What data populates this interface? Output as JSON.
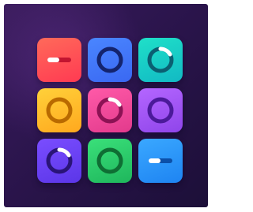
{
  "icon": {
    "name": "launchpad-app-icon",
    "background_colors": [
      "#3a1c5c",
      "#1c0f38"
    ],
    "pads": [
      {
        "name": "pad-red-slider",
        "color": "#ff4a55",
        "symbol": "slider",
        "symbol_color": "#c21530",
        "fill": 0.5
      },
      {
        "name": "pad-blue-ring",
        "color": "#3f74f8",
        "symbol": "ring",
        "symbol_color": "#14246e"
      },
      {
        "name": "pad-teal-ring-progress",
        "color": "#16c6c6",
        "symbol": "ring-progress",
        "symbol_color": "#0b5f72",
        "progress": 0.3
      },
      {
        "name": "pad-yellow-ring",
        "color": "#ffbe2a",
        "symbol": "ring",
        "symbol_color": "#b96a00"
      },
      {
        "name": "pad-pink-ring-progress",
        "color": "#f0479a",
        "symbol": "ring-progress",
        "symbol_color": "#8c1254",
        "progress": 0.3
      },
      {
        "name": "pad-purple-ring",
        "color": "#a255f5",
        "symbol": "ring",
        "symbol_color": "#4b1a9a"
      },
      {
        "name": "pad-violet-ring-progress",
        "color": "#6a40f2",
        "symbol": "ring-progress",
        "symbol_color": "#2a1478",
        "progress": 0.3
      },
      {
        "name": "pad-green-ring",
        "color": "#2bcb6a",
        "symbol": "ring",
        "symbol_color": "#0f6e34"
      },
      {
        "name": "pad-blue-slider",
        "color": "#2e95f8",
        "symbol": "slider",
        "symbol_color": "#0b4fa8",
        "fill": 0.5
      }
    ]
  }
}
